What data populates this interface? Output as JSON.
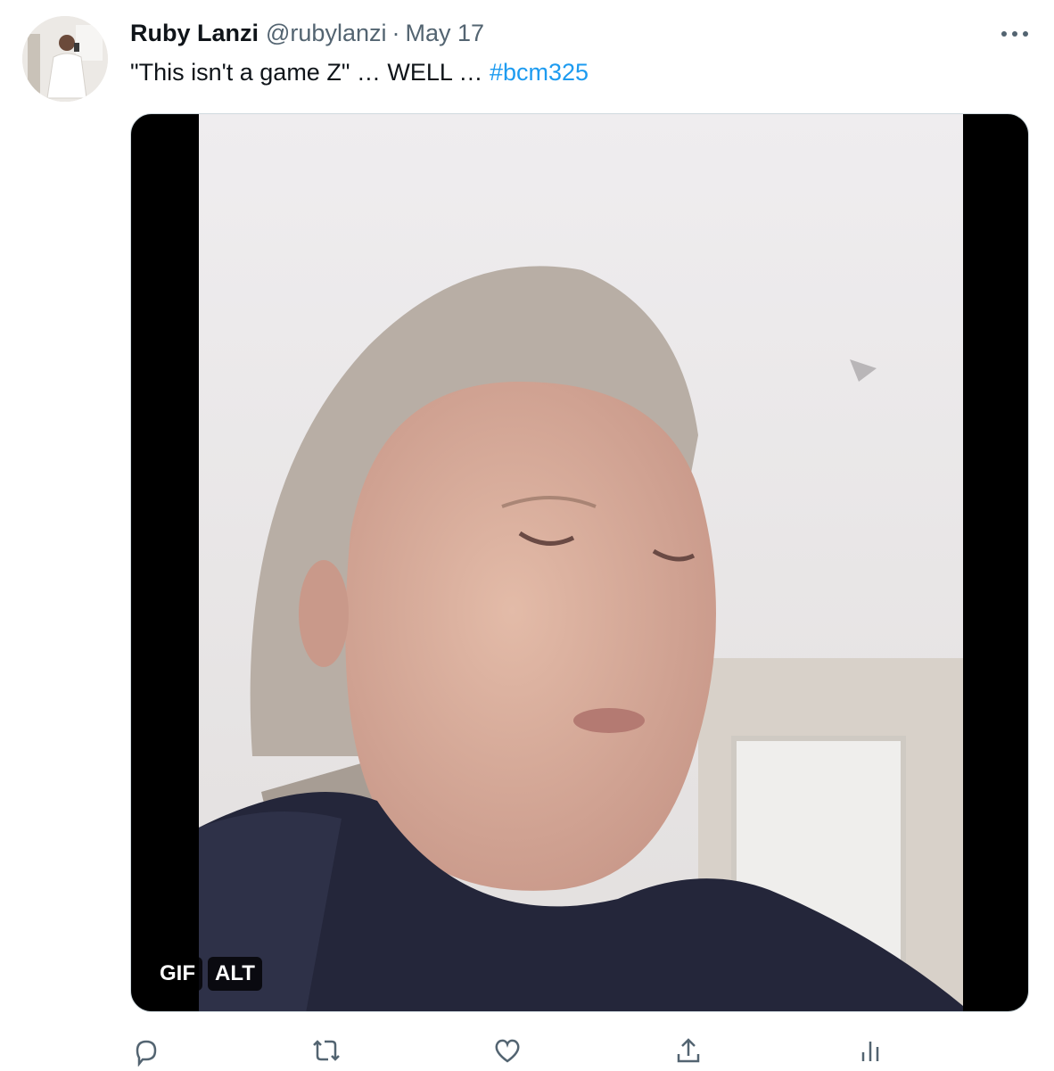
{
  "tweet": {
    "author_name": "Ruby Lanzi",
    "handle": "@rubylanzi",
    "separator": "·",
    "date": "May 17",
    "text_prefix": "\"This isn't a game Z\" … WELL … ",
    "hashtag": "#bcm325",
    "more_icon": "more-horizontal-icon"
  },
  "media": {
    "badges": [
      "GIF",
      "ALT"
    ]
  },
  "actions": [
    {
      "name": "reply-button",
      "icon": "reply-icon"
    },
    {
      "name": "retweet-button",
      "icon": "retweet-icon"
    },
    {
      "name": "like-button",
      "icon": "heart-icon"
    },
    {
      "name": "share-button",
      "icon": "share-icon"
    },
    {
      "name": "analytics-button",
      "icon": "analytics-icon"
    }
  ],
  "colors": {
    "text": "#0f1419",
    "secondary": "#536471",
    "link": "#1d9bf0"
  }
}
